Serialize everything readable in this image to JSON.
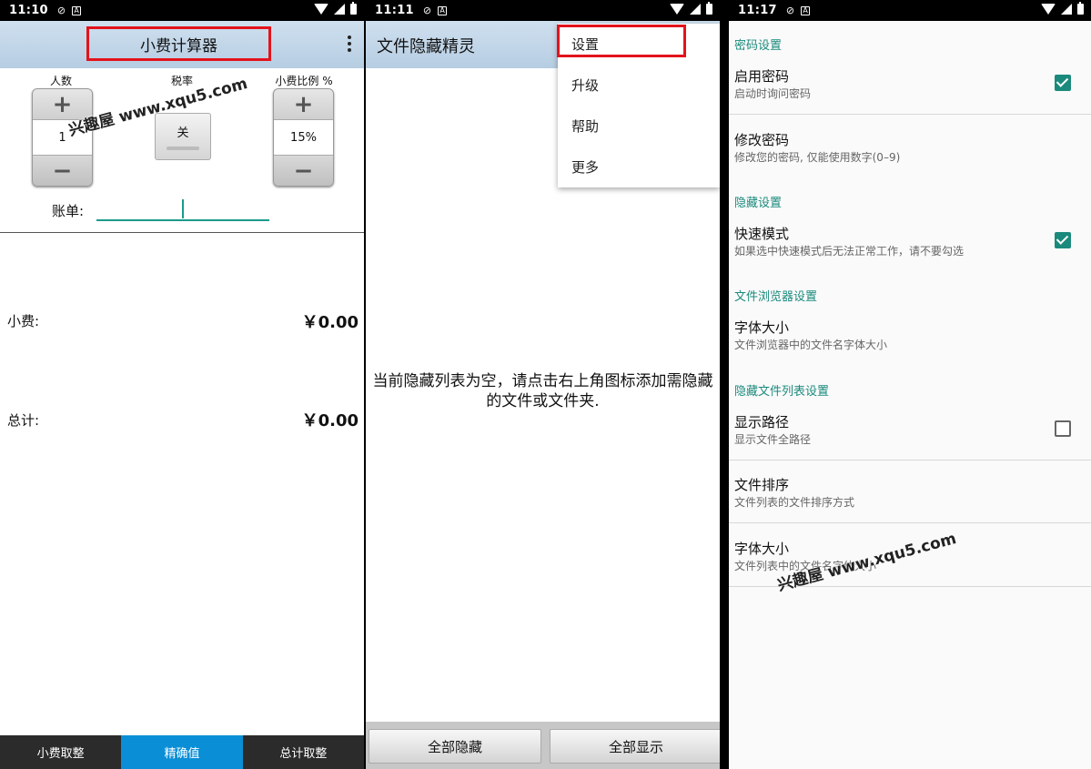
{
  "status": {
    "s1_time": "11:10",
    "s2_time": "11:11",
    "s3_time": "11:17"
  },
  "watermark": "兴趣屋 www.xqu5.com",
  "calc": {
    "title": "小费计算器",
    "people_label": "人数",
    "tax_label": "税率",
    "tip_label": "小费比例 %",
    "people_value": "1",
    "tax_value": "关",
    "tip_value": "15%",
    "bill_label": "账单:",
    "tip_row_label": "小费:",
    "tip_row_value": "￥0.00",
    "total_label": "总计:",
    "total_value": "￥0.00",
    "tabs": [
      "小费取整",
      "精确值",
      "总计取整"
    ]
  },
  "hider": {
    "title": "文件隐藏精灵",
    "menu": [
      "设置",
      "升级",
      "帮助",
      "更多"
    ],
    "empty_message": "当前隐藏列表为空，请点击右上角图标添加需隐藏的文件或文件夹.",
    "hide_all": "全部隐藏",
    "show_all": "全部显示"
  },
  "settings": {
    "sec_password": "密码设置",
    "enable_pw_title": "启用密码",
    "enable_pw_sub": "启动时询问密码",
    "change_pw_title": "修改密码",
    "change_pw_sub": "修改您的密码, 仅能使用数字(0–9)",
    "sec_hide": "隐藏设置",
    "quick_title": "快速模式",
    "quick_sub": "如果选中快速模式后无法正常工作，请不要勾选",
    "sec_browser": "文件浏览器设置",
    "font_title": "字体大小",
    "font_sub": "文件浏览器中的文件名字体大小",
    "sec_list": "隐藏文件列表设置",
    "path_title": "显示路径",
    "path_sub": "显示文件全路径",
    "sort_title": "文件排序",
    "sort_sub": "文件列表的文件排序方式",
    "font2_title": "字体大小",
    "font2_sub": "文件列表中的文件名字体大小"
  },
  "colors": {
    "accent": "#1b8a7c",
    "highlight": "#e3131b",
    "tab_active": "#0a8fd6"
  }
}
